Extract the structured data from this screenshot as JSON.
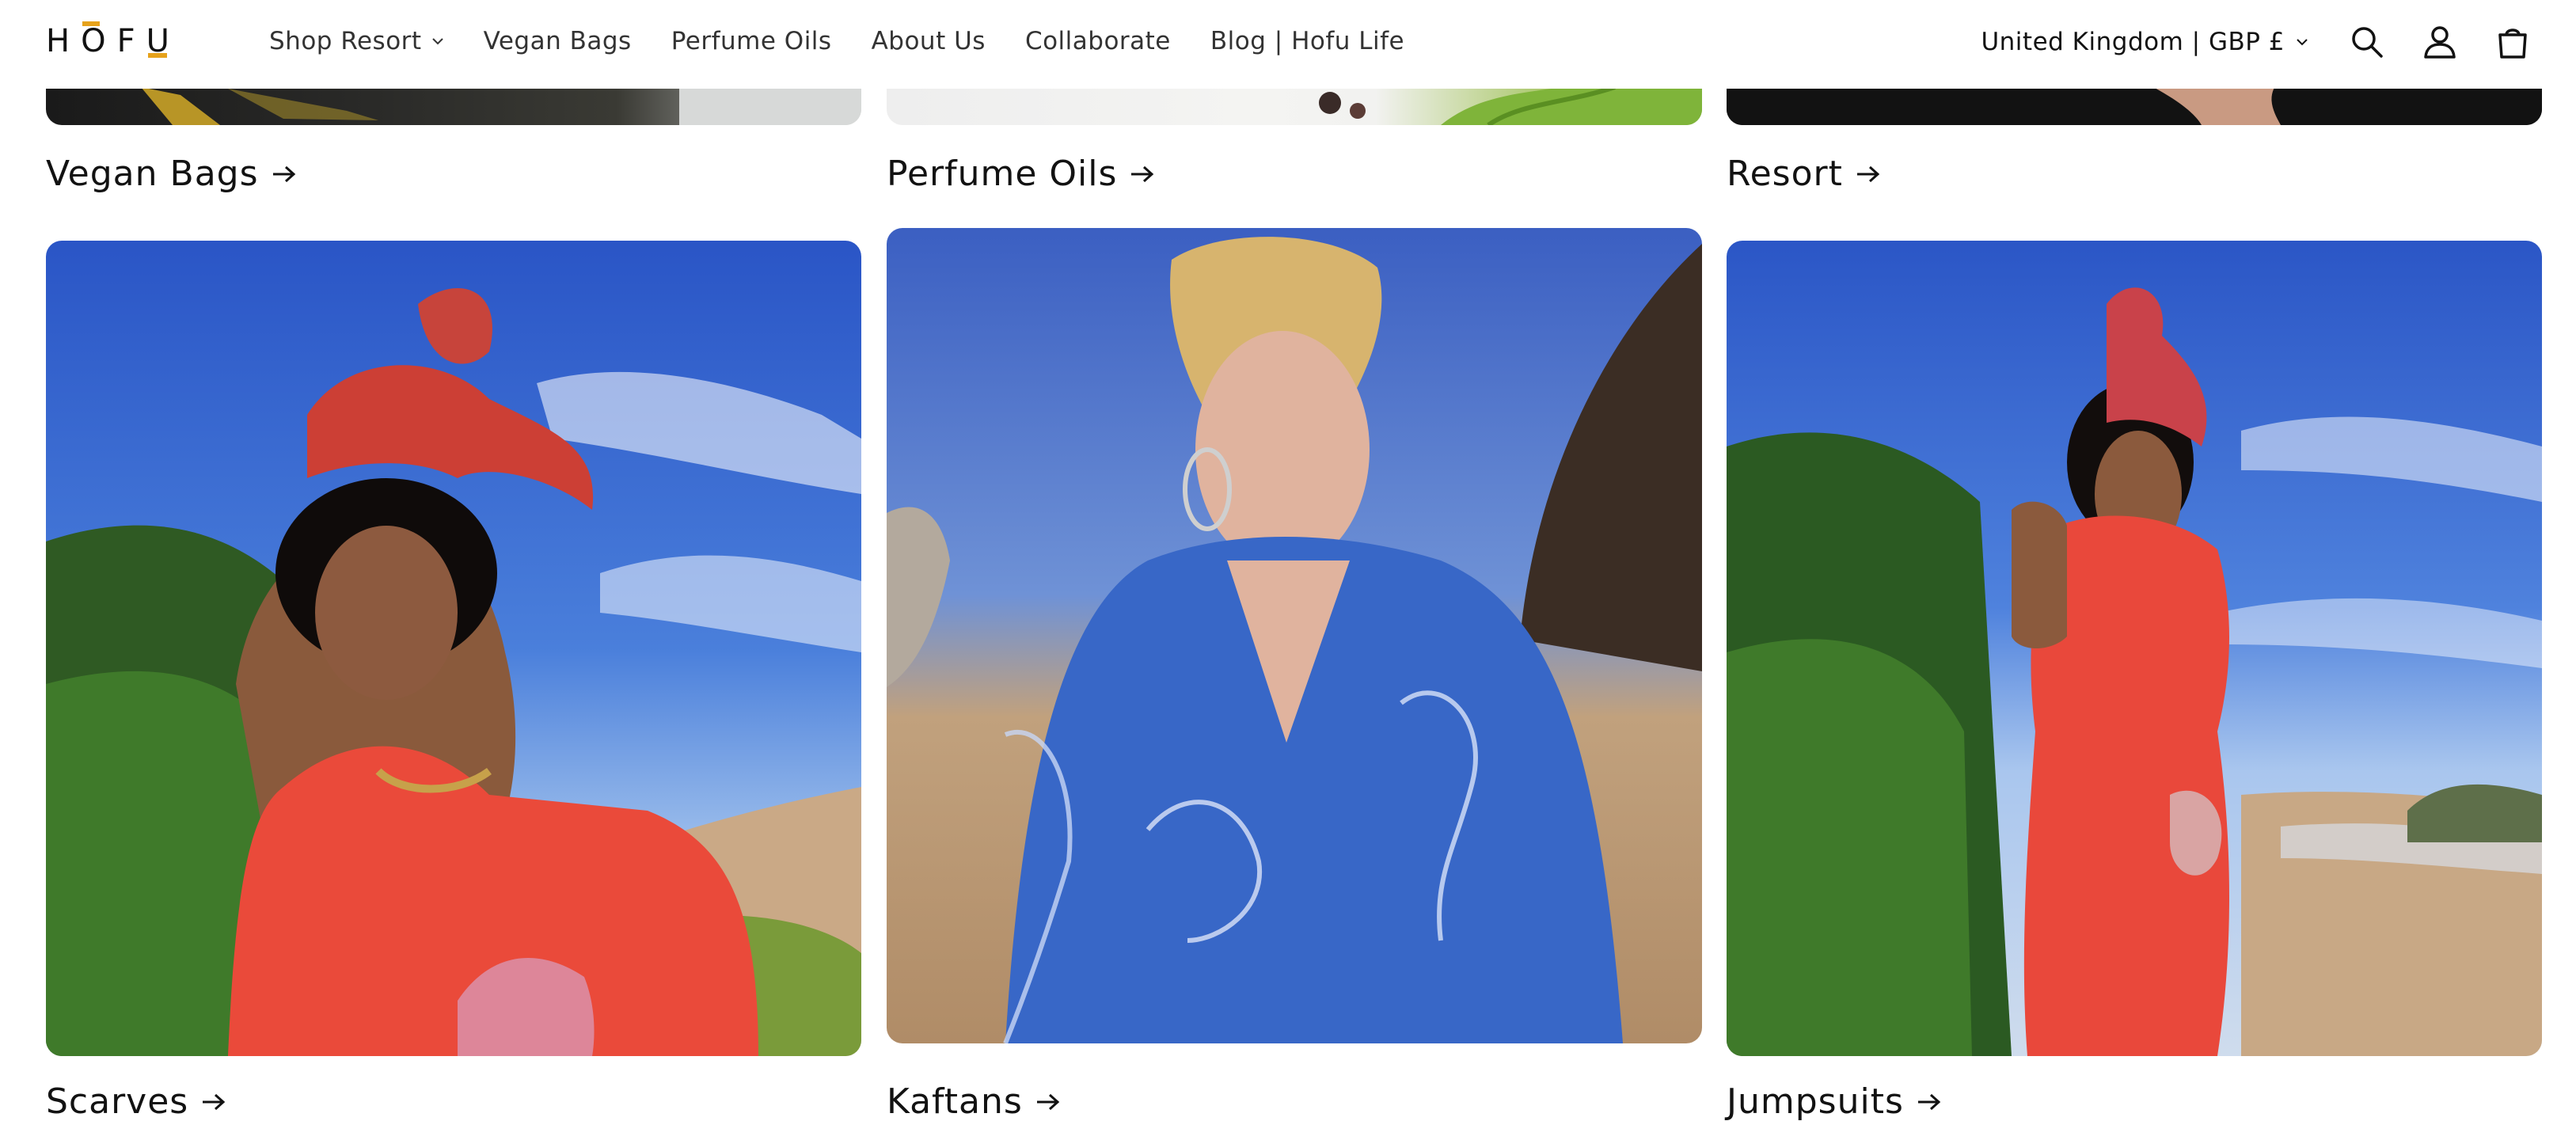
{
  "header": {
    "logo_text": "HOFU",
    "nav": [
      {
        "label": "Shop Resort",
        "has_dropdown": true
      },
      {
        "label": "Vegan Bags",
        "has_dropdown": false
      },
      {
        "label": "Perfume Oils",
        "has_dropdown": false
      },
      {
        "label": "About Us",
        "has_dropdown": false
      },
      {
        "label": "Collaborate",
        "has_dropdown": false
      },
      {
        "label": "Blog | Hofu Life",
        "has_dropdown": false
      }
    ],
    "country_selector": "United Kingdom | GBP £",
    "icons": [
      "search-icon",
      "account-icon",
      "cart-icon"
    ]
  },
  "collections_row1": [
    {
      "title": "Vegan Bags"
    },
    {
      "title": "Perfume Oils"
    },
    {
      "title": "Resort"
    }
  ],
  "collections_row2": [
    {
      "title": "Scarves"
    },
    {
      "title": "Kaftans"
    },
    {
      "title": "Jumpsuits"
    }
  ],
  "colors": {
    "text": "#121212",
    "accent": "#e6a21b"
  }
}
